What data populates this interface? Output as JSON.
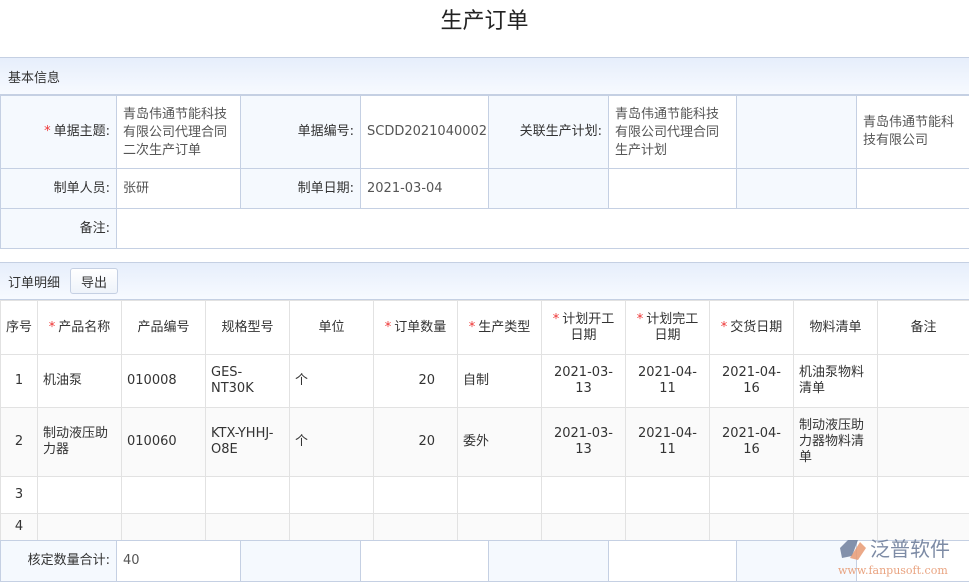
{
  "title": "生产订单",
  "basic": {
    "section_label": "基本信息",
    "subject_label": "单据主题:",
    "subject_value": "青岛伟通节能科技有限公司代理合同二次生产订单",
    "number_label": "单据编号:",
    "number_value": "SCDD2021040002",
    "plan_label": "关联生产计划:",
    "plan_value": "青岛伟通节能科技有限公司代理合同生产计划",
    "company_value": "青岛伟通节能科技有限公司",
    "creator_label": "制单人员:",
    "creator_value": "张研",
    "date_label": "制单日期:",
    "date_value": "2021-03-04",
    "remark_label": "备注:"
  },
  "detail": {
    "section_label": "订单明细",
    "export_label": "导出",
    "headers": [
      "序号",
      "产品名称",
      "产品编号",
      "规格型号",
      "单位",
      "订单数量",
      "生产类型",
      "计划开工日期",
      "计划完工日期",
      "交货日期",
      "物料清单",
      "备注"
    ],
    "rows": [
      [
        "1",
        "机油泵",
        "010008",
        "GES-NT30K",
        "个",
        "20",
        "自制",
        "2021-03-13",
        "2021-04-11",
        "2021-04-16",
        "机油泵物料清单",
        ""
      ],
      [
        "2",
        "制动液压助力器",
        "010060",
        "KTX-YHHJ-O8E",
        "个",
        "20",
        "委外",
        "2021-03-13",
        "2021-04-11",
        "2021-04-16",
        "制动液压助力器物料清单",
        ""
      ],
      [
        "3",
        "",
        "",
        "",
        "",
        "",
        "",
        "",
        "",
        "",
        "",
        ""
      ],
      [
        "4",
        "",
        "",
        "",
        "",
        "",
        "",
        "",
        "",
        "",
        "",
        ""
      ]
    ]
  },
  "footer": {
    "total_label": "核定数量合计:",
    "total_value": "40"
  },
  "watermark": {
    "brand": "泛普软件",
    "url": "www.fanpusoft.com"
  }
}
